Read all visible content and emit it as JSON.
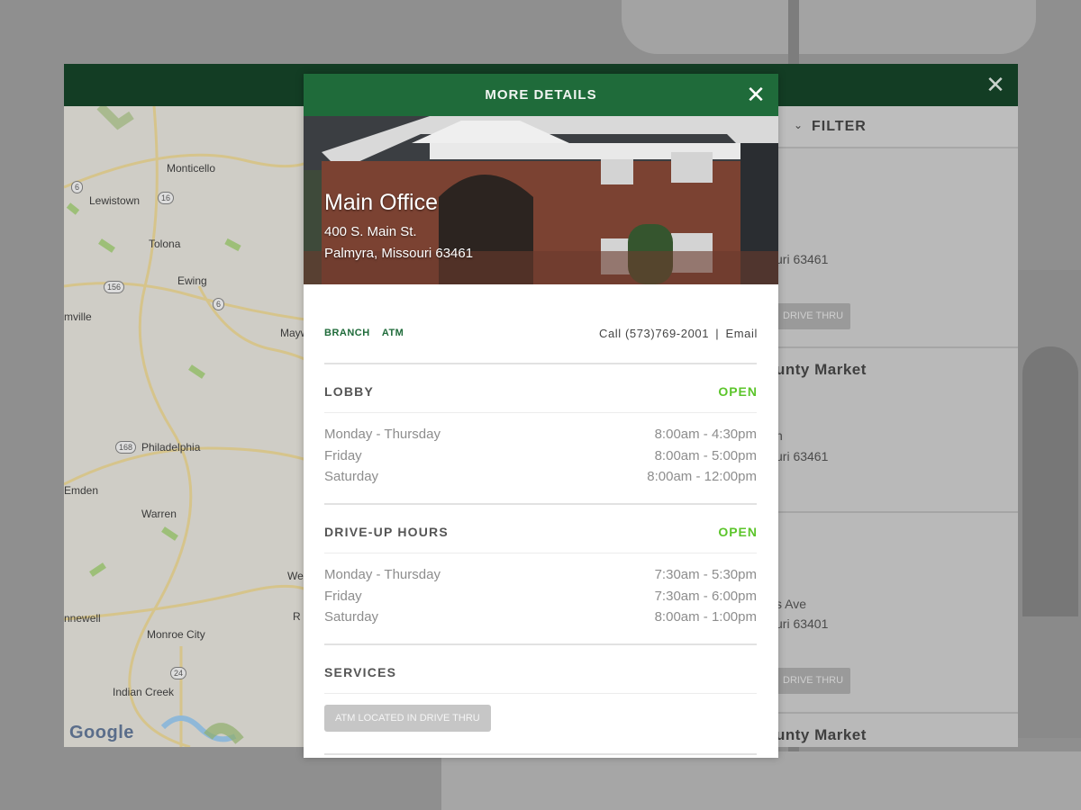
{
  "app": {
    "filter_label": "FILTER",
    "list_items": [
      {
        "line": "uri 63461"
      },
      {
        "tag": "DRIVE THRU"
      },
      {
        "name": "unty Market"
      },
      {
        "line1": "n",
        "line2": "uri 63461"
      },
      {
        "line1": "s Ave",
        "line2": "uri 63401"
      },
      {
        "tag": "DRIVE THRU"
      },
      {
        "name": "unty Market"
      }
    ]
  },
  "map": {
    "labels": [
      "Monticello",
      "Lewistown",
      "Tolona",
      "Ewing",
      "Maywoo",
      "mville",
      "Philadelphia",
      "Emden",
      "Warren",
      "We",
      "R",
      "nnewell",
      "Monroe City",
      "Indian Creek"
    ],
    "shields": [
      "6",
      "16",
      "156",
      "6",
      "168",
      "24"
    ],
    "attribution": "Google"
  },
  "modal": {
    "title": "MORE DETAILS",
    "location_name": "Main Office",
    "address_line1": "400 S. Main St.",
    "address_line2": "Palmyra, Missouri 63461",
    "types": [
      "BRANCH",
      "ATM"
    ],
    "contact": {
      "call_label": "Call",
      "phone": "(573)769-2001",
      "separator": "|",
      "email_label": "Email"
    },
    "lobby": {
      "title": "LOBBY",
      "status": "OPEN",
      "hours": [
        {
          "day": "Monday - Thursday",
          "time": "8:00am - 4:30pm"
        },
        {
          "day": "Friday",
          "time": "8:00am - 5:00pm"
        },
        {
          "day": "Saturday",
          "time": "8:00am - 12:00pm"
        }
      ]
    },
    "drive_up": {
      "title": "DRIVE-UP HOURS",
      "status": "OPEN",
      "hours": [
        {
          "day": "Monday - Thursday",
          "time": "7:30am - 5:30pm"
        },
        {
          "day": "Friday",
          "time": "7:30am - 6:00pm"
        },
        {
          "day": "Saturday",
          "time": "8:00am - 1:00pm"
        }
      ]
    },
    "services": {
      "title": "SERVICES",
      "items": [
        "ATM LOCATED IN DRIVE THRU"
      ]
    }
  },
  "colors": {
    "header_green": "#1f6b3a",
    "app_header_green": "#133d24",
    "open_green": "#5cc52b",
    "tag_green": "#1f6b3a"
  },
  "icons": {
    "close": "close-icon",
    "filter": "chevron-down-icon"
  }
}
